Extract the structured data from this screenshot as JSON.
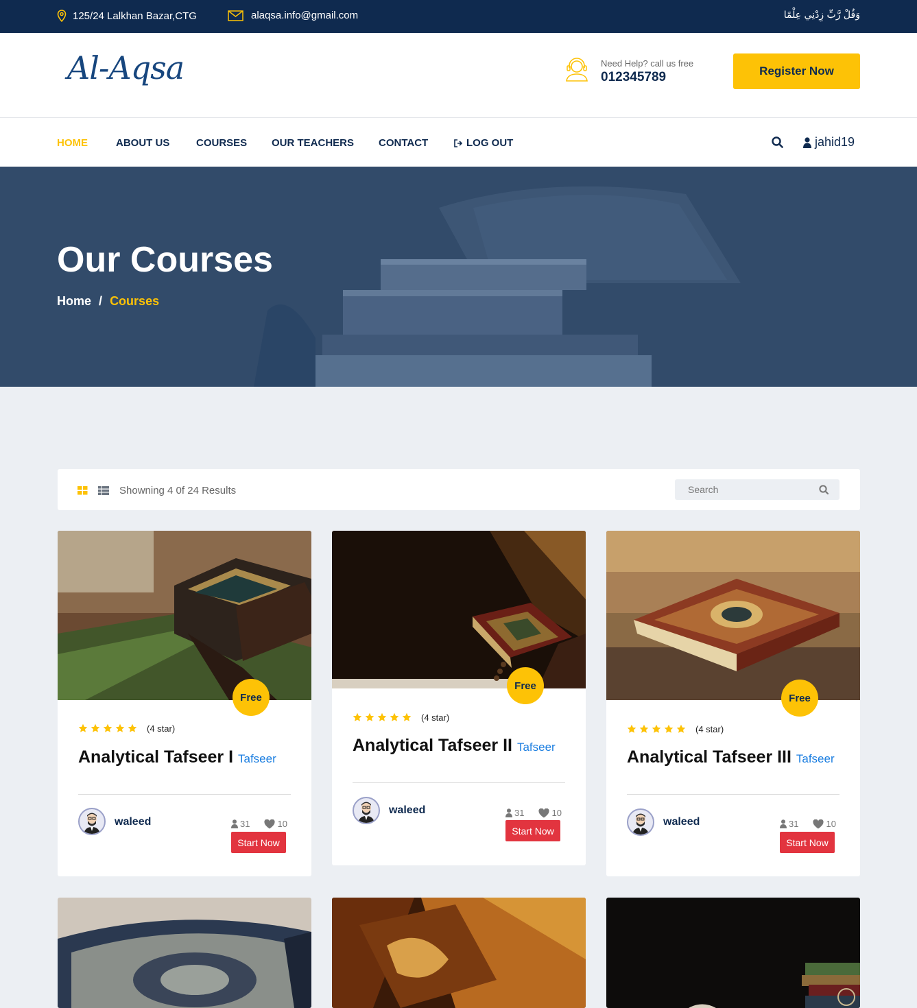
{
  "topbar": {
    "address": "125/24 Lalkhan Bazar,CTG",
    "email": "alaqsa.info@gmail.com",
    "arabic_text": "وَقُلْ رَّبِّ زِدْنِي عِلْمًا"
  },
  "header": {
    "logo": "Al-Aqsa",
    "help_label": "Need Help? call us free",
    "help_phone": "012345789",
    "register_label": "Register Now"
  },
  "nav": {
    "items": [
      "HOME",
      "ABOUT US",
      "COURSES",
      "OUR TEACHERS",
      "CONTACT",
      "LOG OUT"
    ],
    "username": "jahid19"
  },
  "hero": {
    "title": "Our Courses",
    "breadcrumb_home": "Home",
    "breadcrumb_sep": "/",
    "breadcrumb_current": "Courses"
  },
  "toolbar": {
    "results_text": "Showning 4 0f 24 Results",
    "search_placeholder": "Search"
  },
  "courses": [
    {
      "badge": "Free",
      "rating": "(4 star)",
      "title": "Analytical Tafseer I",
      "category": "Tafseer",
      "author": "waleed",
      "students": "31",
      "likes": "10",
      "button": "Start Now"
    },
    {
      "badge": "Free",
      "rating": "(4 star)",
      "title": "Analytical Tafseer II",
      "category": "Tafseer",
      "author": "waleed",
      "students": "31",
      "likes": "10",
      "button": "Start Now"
    },
    {
      "badge": "Free",
      "rating": "(4 star)",
      "title": "Analytical Tafseer III",
      "category": "Tafseer",
      "author": "waleed",
      "students": "31",
      "likes": "10",
      "button": "Start Now"
    }
  ],
  "colors": {
    "navy": "#0f2a4f",
    "accent": "#fdc206",
    "button_red": "#e2343f",
    "category_blue": "#1b7ee0"
  }
}
